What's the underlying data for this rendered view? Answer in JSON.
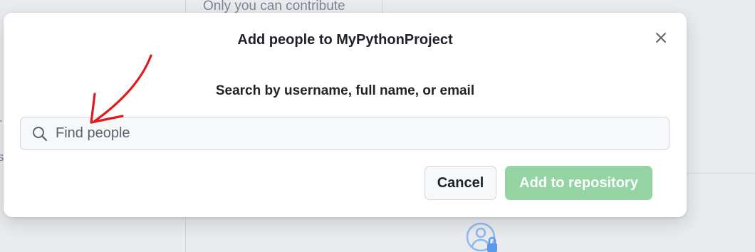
{
  "background": {
    "clipped_text": "Only you can contribute",
    "edge_glyph_1": "r",
    "edge_glyph_2": "s",
    "icon": "user-lock-icon"
  },
  "dialog": {
    "title": "Add people to MyPythonProject",
    "close_icon": "close-icon",
    "search_heading": "Search by username, full name, or email",
    "search": {
      "placeholder": "Find people",
      "value": "",
      "icon": "search-icon"
    },
    "buttons": {
      "cancel_label": "Cancel",
      "add_label": "Add to repository"
    }
  },
  "annotation": {
    "type": "hand-drawn-arrow",
    "color": "#e0191e"
  },
  "colors": {
    "add_button_disabled": "#94d3a2",
    "dialog_background": "#ffffff",
    "page_background": "#e9ebee"
  }
}
